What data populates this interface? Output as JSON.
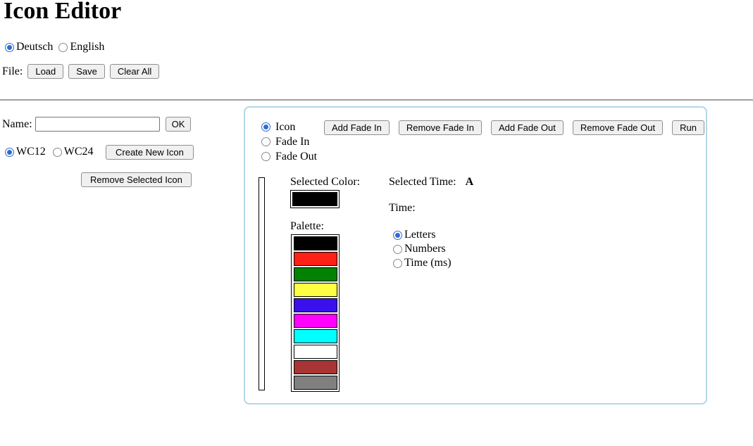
{
  "title": "Icon Editor",
  "language": {
    "options": [
      {
        "label": "Deutsch",
        "selected": true
      },
      {
        "label": "English",
        "selected": false
      }
    ]
  },
  "file": {
    "label": "File:",
    "load": "Load",
    "save": "Save",
    "clear": "Clear All"
  },
  "name_row": {
    "label": "Name:",
    "value": "",
    "ok": "OK"
  },
  "icon_section": {
    "options": [
      {
        "label": "WC12",
        "selected": true
      },
      {
        "label": "WC24",
        "selected": false
      }
    ],
    "create": "Create New Icon",
    "remove": "Remove Selected Icon"
  },
  "panel": {
    "mode_options": [
      {
        "label": "Icon",
        "selected": true
      },
      {
        "label": "Fade In",
        "selected": false
      },
      {
        "label": "Fade Out",
        "selected": false
      }
    ],
    "buttons": {
      "add_fade_in": "Add Fade In",
      "remove_fade_in": "Remove Fade In",
      "add_fade_out": "Add Fade Out",
      "remove_fade_out": "Remove Fade Out",
      "run": "Run"
    },
    "selected_color": {
      "label": "Selected Color:",
      "value": "#000000"
    },
    "palette": {
      "label": "Palette:",
      "colors": [
        "#000000",
        "#ff2115",
        "#028102",
        "#ffff42",
        "#3a10ec",
        "#ff00ff",
        "#00ffff",
        "#ffffff",
        "#a93434",
        "#808080"
      ]
    },
    "selected_time": {
      "label": "Selected Time:",
      "value": "A"
    },
    "time": {
      "label": "Time:",
      "options": [
        {
          "label": "Letters",
          "selected": true
        },
        {
          "label": "Numbers",
          "selected": false
        },
        {
          "label": "Time (ms)",
          "selected": false
        }
      ]
    }
  },
  "colors": {
    "panel_border": "#b3d7e8",
    "radio_accent": "#2e6bd3"
  }
}
